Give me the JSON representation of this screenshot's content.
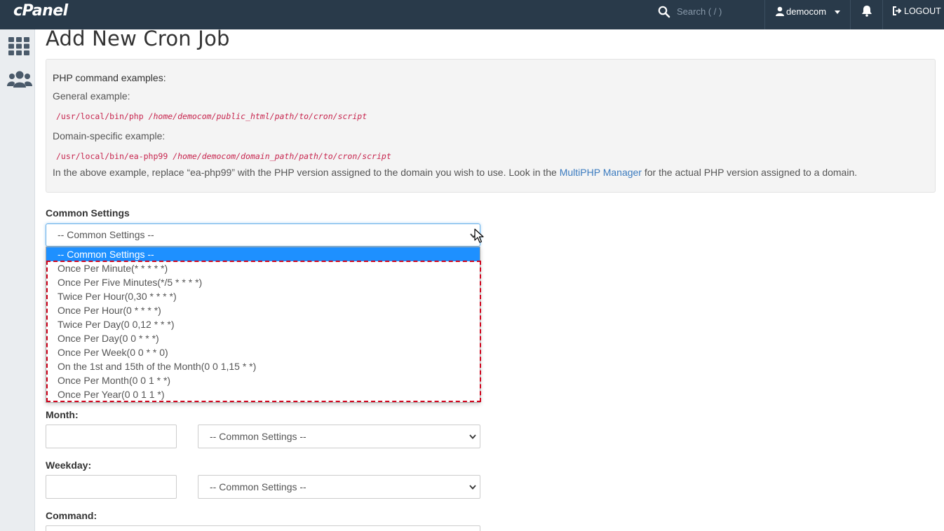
{
  "header": {
    "logo": "cPanel",
    "search_placeholder": "Search ( / )",
    "username": "democom",
    "logout_label": "LOGOUT"
  },
  "page_title": "Add New Cron Job",
  "info": {
    "heading": "PHP command examples:",
    "general_label": "General example:",
    "general_cmd_bin": "/usr/local/bin/php",
    "general_cmd_path": "/home/democom/public_html/path/to/cron/script",
    "domain_label": "Domain-specific example:",
    "domain_cmd_bin": "/usr/local/bin/ea-php99",
    "domain_cmd_path": "/home/democom/domain_path/path/to/cron/script",
    "note_before": "In the above example, replace “ea-php99” with the PHP version assigned to the domain you wish to use. Look in the",
    "note_link": "MultiPHP Manager",
    "note_after": "for the actual PHP version assigned to a domain."
  },
  "common_settings": {
    "label": "Common Settings",
    "selected": "-- Common Settings --",
    "options": [
      "-- Common Settings --",
      "Once Per Minute(* * * * *)",
      "Once Per Five Minutes(*/5 * * * *)",
      "Twice Per Hour(0,30 * * * *)",
      "Once Per Hour(0 * * * *)",
      "Twice Per Day(0 0,12 * * *)",
      "Once Per Day(0 0 * * *)",
      "Once Per Week(0 0 * * 0)",
      "On the 1st and 15th of the Month(0 0 1,15 * *)",
      "Once Per Month(0 0 1 * *)",
      "Once Per Year(0 0 1 1 *)"
    ]
  },
  "month": {
    "label": "Month:",
    "value": "",
    "select": "-- Common Settings --"
  },
  "weekday": {
    "label": "Weekday:",
    "value": "",
    "select": "-- Common Settings --"
  },
  "command": {
    "label": "Command:"
  },
  "colors": {
    "topbar": "#293a4a",
    "highlight": "#d0021b",
    "selected_option": "#1e90ff",
    "link": "#3b7bbf"
  }
}
